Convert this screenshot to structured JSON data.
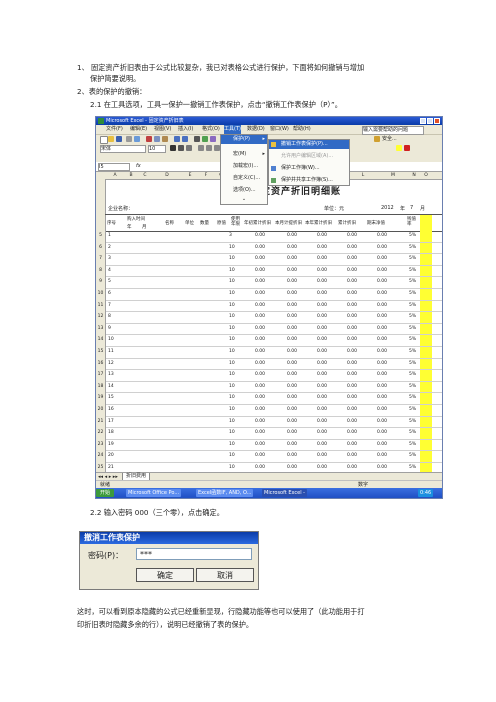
{
  "paragraphs": {
    "p1_line1": "1、 固定资产折旧表由于公式比较复杂，我已对表格公式进行保护，下面将如何撤销与增加",
    "p1_line2": "保护简要说明。",
    "p2": "2、表的保护的撤销：",
    "p21": "2.1 在工具选项，工具一保护一撤销工作表保护，点击“撤销工作表保护（P）”。",
    "p22": "2.2  输入密码 000（三个零），点击确定。",
    "p3_line1": "这时，可以看到原本隐藏的公式已经重新显现，行隐藏功能等也可以使用了（此功能用于打",
    "p3_line2": "印折旧表时隐藏多余的行），说明已经撤销了表的保护。"
  },
  "excel": {
    "window_title": "Microsoft Excel - 固定资产折旧表",
    "menus": [
      "文件(F)",
      "编辑(E)",
      "视图(V)",
      "插入(I)",
      "格式(O)",
      "工具(T)",
      "数据(D)",
      "窗口(W)",
      "帮助(H)"
    ],
    "help_box": "输入需要帮助的问题",
    "font_name": "宋体",
    "font_size": "10",
    "cell_ref": "I5",
    "fx": "fx",
    "security_btn": "安全...",
    "tools_menu": [
      "保护(P)",
      "宏(M)",
      "加载宏(I)...",
      "自定义(C)...",
      "选项(O)..."
    ],
    "protect_submenu": [
      "撤销工作表保护(P)...",
      "允许用户编辑区域(A)...",
      "保护工作簿(W)...",
      "保护并共享工作簿(S)..."
    ],
    "sheet_title": "定资产折旧明细账",
    "company_label": "企业名称：",
    "unit_label": "单位：元",
    "year": "2012",
    "year_label": "年",
    "month": "7",
    "month_label": "月",
    "headers": [
      "序号",
      "购入时间",
      "名称",
      "单位",
      "数量",
      "原值",
      "使用年限",
      "年初累计折旧",
      "本月计提折旧",
      "本年累计折旧",
      "累计折旧",
      "期末净值",
      "残值率",
      "备注"
    ],
    "subheaders": [
      "年",
      "月"
    ],
    "col_letters": [
      "A",
      "B",
      "C",
      "D",
      "E",
      "F",
      "G",
      "H",
      "I",
      "J",
      "K",
      "L",
      "M",
      "N",
      "O"
    ],
    "rows": [
      {
        "rn": "5",
        "no": "1",
        "life": "3",
        "v": "0.00",
        "rate": "5%"
      },
      {
        "rn": "6",
        "no": "2",
        "life": "10",
        "v": "0.00",
        "rate": "5%"
      },
      {
        "rn": "7",
        "no": "3",
        "life": "10",
        "v": "0.00",
        "rate": "5%"
      },
      {
        "rn": "8",
        "no": "4",
        "life": "10",
        "v": "0.00",
        "rate": "5%"
      },
      {
        "rn": "9",
        "no": "5",
        "life": "10",
        "v": "0.00",
        "rate": "5%"
      },
      {
        "rn": "10",
        "no": "6",
        "life": "10",
        "v": "0.00",
        "rate": "5%"
      },
      {
        "rn": "11",
        "no": "7",
        "life": "10",
        "v": "0.00",
        "rate": "5%"
      },
      {
        "rn": "12",
        "no": "8",
        "life": "10",
        "v": "0.00",
        "rate": "5%"
      },
      {
        "rn": "13",
        "no": "9",
        "life": "10",
        "v": "0.00",
        "rate": "5%"
      },
      {
        "rn": "14",
        "no": "10",
        "life": "10",
        "v": "0.00",
        "rate": "5%"
      },
      {
        "rn": "15",
        "no": "11",
        "life": "10",
        "v": "0.00",
        "rate": "5%"
      },
      {
        "rn": "16",
        "no": "12",
        "life": "10",
        "v": "0.00",
        "rate": "5%"
      },
      {
        "rn": "17",
        "no": "13",
        "life": "10",
        "v": "0.00",
        "rate": "5%"
      },
      {
        "rn": "18",
        "no": "14",
        "life": "10",
        "v": "0.00",
        "rate": "5%"
      },
      {
        "rn": "19",
        "no": "15",
        "life": "10",
        "v": "0.00",
        "rate": "5%"
      },
      {
        "rn": "20",
        "no": "16",
        "life": "10",
        "v": "0.00",
        "rate": "5%"
      },
      {
        "rn": "21",
        "no": "17",
        "life": "10",
        "v": "0.00",
        "rate": "5%"
      },
      {
        "rn": "22",
        "no": "18",
        "life": "10",
        "v": "0.00",
        "rate": "5%"
      },
      {
        "rn": "23",
        "no": "19",
        "life": "10",
        "v": "0.00",
        "rate": "5%"
      },
      {
        "rn": "24",
        "no": "20",
        "life": "10",
        "v": "0.00",
        "rate": "5%"
      },
      {
        "rn": "25",
        "no": "21",
        "life": "10",
        "v": "0.00",
        "rate": "5%"
      }
    ],
    "sheet_tab": "折旧费用",
    "status_left": "就绪",
    "status_right": "数字",
    "taskbar": [
      "开始",
      "Microsoft Office Po...",
      "Excel函数IF, AND, O...",
      "Microsoft Excel -"
    ],
    "clock": "0:46"
  },
  "dialog": {
    "title": "撤消工作表保护",
    "label": "密码(P)：",
    "value": "***",
    "ok": "确定",
    "cancel": "取消"
  },
  "colors": {
    "title_blue": "#0a3ba8",
    "highlight": "#316ac5",
    "yellow": "#ffff33",
    "chrome": "#ece9d8"
  }
}
